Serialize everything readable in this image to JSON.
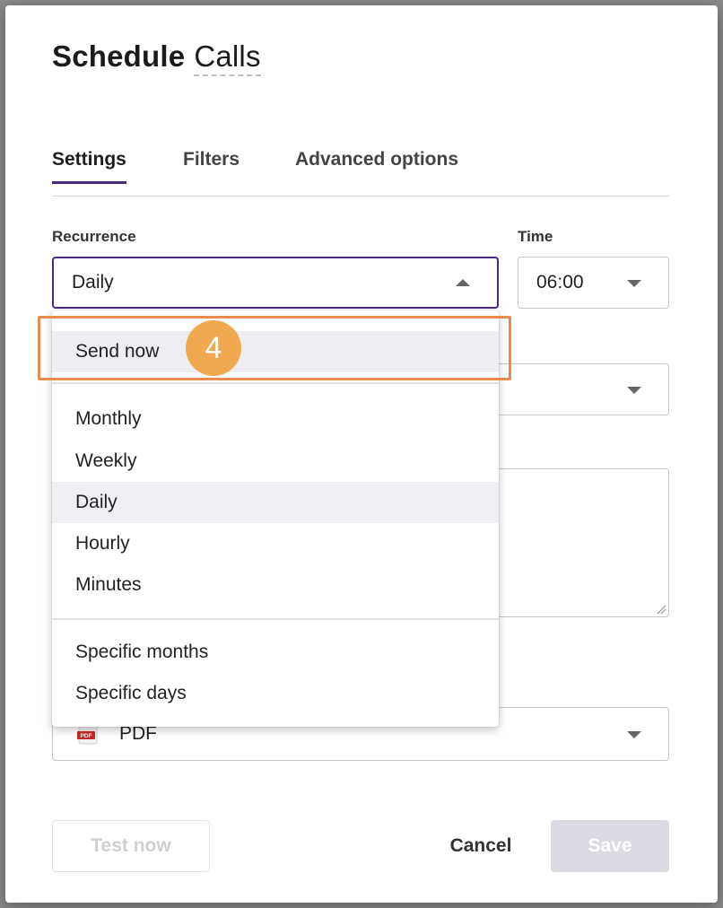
{
  "dialog": {
    "title": "Schedule",
    "report_name": "Calls"
  },
  "tabs": [
    {
      "label": "Settings",
      "active": true
    },
    {
      "label": "Filters",
      "active": false
    },
    {
      "label": "Advanced options",
      "active": false
    }
  ],
  "recurrence": {
    "label": "Recurrence",
    "value": "Daily"
  },
  "time": {
    "label": "Time",
    "value": "06:00"
  },
  "recurrence_menu": {
    "items_top": [
      "Send now"
    ],
    "items_main": [
      "Monthly",
      "Weekly",
      "Daily",
      "Hourly",
      "Minutes"
    ],
    "items_specific": [
      "Specific months",
      "Specific days"
    ],
    "selected": "Daily"
  },
  "format": {
    "value": "PDF",
    "icon": "pdf-file-icon"
  },
  "annotation": {
    "step": "4",
    "color": "#f0a94f",
    "outline_color": "#e88b4f"
  },
  "footer": {
    "test_label": "Test now",
    "cancel_label": "Cancel",
    "save_label": "Save"
  },
  "colors": {
    "accent": "#4a2a7c",
    "save_disabled": "#dcdae3"
  }
}
